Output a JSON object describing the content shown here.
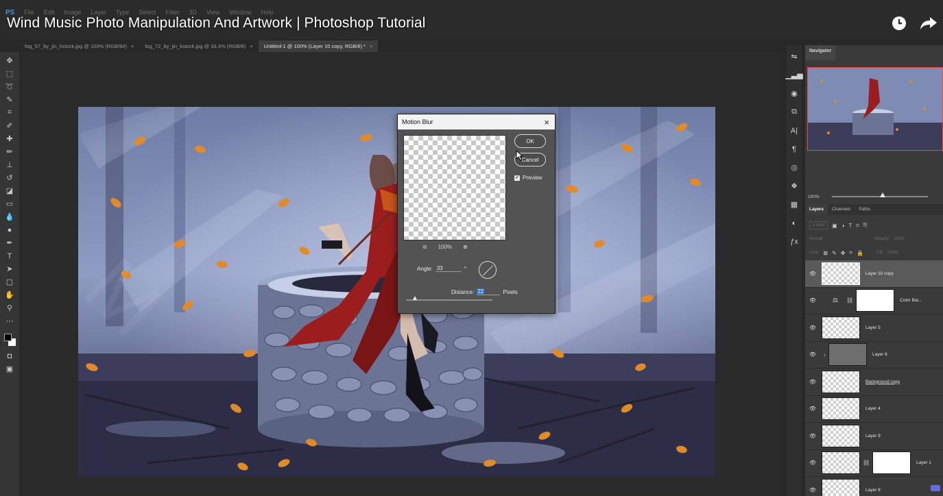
{
  "video": {
    "title": "Wind Music Photo Manipulation And Artwork | Photoshop Tutorial",
    "icons": [
      "clock-icon",
      "share-icon"
    ]
  },
  "menu": {
    "logo": "PS",
    "items": [
      "File",
      "Edit",
      "Image",
      "Layer",
      "Type",
      "Select",
      "Filter",
      "3D",
      "View",
      "Window",
      "Help"
    ]
  },
  "tabs": [
    {
      "label": "fog_57_by_jin_kstock.jpg @ 100% (RGB/8#)",
      "active": false
    },
    {
      "label": "fog_72_by_jin_kstock.jpg @ 33.3% (RGB/8)",
      "active": false
    },
    {
      "label": "Untitled-1 @ 100% (Layer 10 copy, RGB/8) *",
      "active": true
    }
  ],
  "tab_close": "×",
  "navigator": {
    "tab": "Navigator",
    "zoom": "100%"
  },
  "layers_panel": {
    "tabs": [
      "Layers",
      "Channels",
      "Paths"
    ],
    "kind_placeholder": "ρ Kind",
    "blend_mode": "Normal",
    "opacity_label": "Opacity:",
    "opacity_value": "100%",
    "lock_label": "Lock:",
    "fill_label": "Fill:",
    "fill_value": "100%",
    "layers": [
      {
        "name": "Layer 10 copy",
        "selected": true,
        "type": "pixel"
      },
      {
        "name": "Color Bal...",
        "selected": false,
        "type": "adjustment"
      },
      {
        "name": "Layer 5",
        "selected": false,
        "type": "pixel"
      },
      {
        "name": "Layer 6",
        "selected": false,
        "type": "clipped"
      },
      {
        "name": "Background copy",
        "selected": false,
        "type": "image"
      },
      {
        "name": "Layer 4",
        "selected": false,
        "type": "pixel"
      },
      {
        "name": "Layer 9",
        "selected": false,
        "type": "pixel"
      },
      {
        "name": "Layer 1",
        "selected": false,
        "type": "masked"
      },
      {
        "name": "Layer 8",
        "selected": false,
        "type": "pixel"
      }
    ]
  },
  "dialog": {
    "title": "Motion Blur",
    "close": "×",
    "ok": "OK",
    "cancel": "Cancel",
    "preview_label": "Preview",
    "preview_checked": true,
    "preview_zoom": "100%",
    "angle_label": "Angle:",
    "angle_value": "33",
    "angle_unit": "°",
    "distance_label": "Distance:",
    "distance_value": "22",
    "distance_unit": "Pixels"
  },
  "colors": {
    "ps_blue": "#4a8fd6",
    "selection_highlight": "#2f6fd1",
    "navigator_frame": "#e84a3a"
  }
}
